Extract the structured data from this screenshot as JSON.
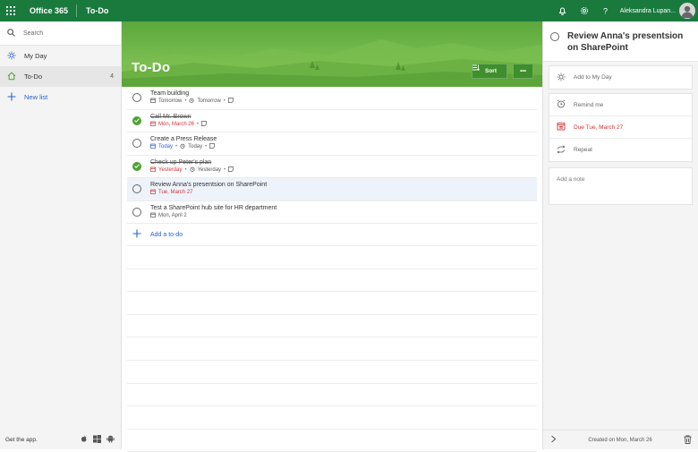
{
  "header": {
    "suite": "Office 365",
    "app": "To-Do",
    "username": "Aleksandra Lupan...",
    "icons": [
      "waffle-icon",
      "bell-icon",
      "gear-icon",
      "help-icon",
      "avatar"
    ]
  },
  "sidebar": {
    "search_placeholder": "Search",
    "items": [
      {
        "label": "My Day",
        "icon": "sun-icon",
        "count": ""
      },
      {
        "label": "To-Do",
        "icon": "home-icon",
        "count": "4"
      }
    ],
    "new_list": "New list",
    "footer": "Get the app."
  },
  "main": {
    "list_title": "To-Do",
    "sort_label": "Sort",
    "more_label": "•••",
    "tasks": [
      {
        "title": "Team building",
        "done": false,
        "d1": "Tomorrow",
        "d2": "Tomorrow"
      },
      {
        "title": "Call Mr. Brown",
        "done": true,
        "d1": "Mon, March 26",
        "d2": ""
      },
      {
        "title": "Create a Press Release",
        "done": false,
        "d1": "Today",
        "d2": "Today"
      },
      {
        "title": "Check up Peter's plan",
        "done": true,
        "d1": "Yesterday",
        "d2": "Yesterday"
      },
      {
        "title": "Review Anna's presentsion on SharePoint",
        "done": false,
        "d1": "Tue, March 27",
        "d2": ""
      },
      {
        "title": "Test a SharePoint hub site for HR department",
        "done": false,
        "d1": "Mon, April 2",
        "d2": ""
      }
    ],
    "add_todo": "Add a to-do"
  },
  "detail": {
    "title": "Review Anna's presentsion on SharePoint",
    "add_my_day": "Add to My Day",
    "remind": "Remind me",
    "due": "Due Tue, March 27",
    "repeat": "Repeat",
    "note_placeholder": "Add a note",
    "created": "Created on Mon, March 26"
  },
  "colors": {
    "topbar": "#1a7a3e",
    "accent": "#2564cf",
    "done": "#4ca22f",
    "due": "#d13438"
  }
}
